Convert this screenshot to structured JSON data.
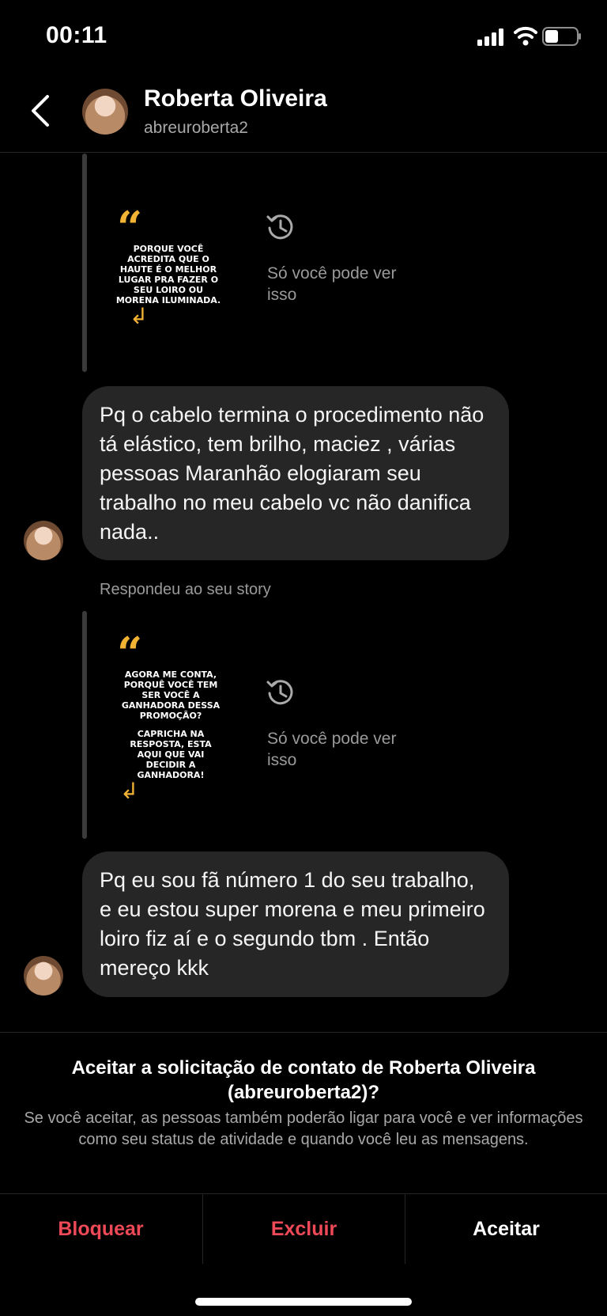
{
  "status_bar": {
    "time": "00:11",
    "icons": [
      "signal-icon",
      "wifi-icon",
      "battery-icon"
    ]
  },
  "header": {
    "name": "Roberta Oliveira",
    "username": "abreuroberta2",
    "back_icon": "chevron-left-icon"
  },
  "messages": [
    {
      "type": "story_reply",
      "story_text": "PORQUE VOCÊ ACREDITA QUE O HAUTE É O MELHOR LUGAR PRA FAZER O SEU LOIRO OU MORENA ILUMINADA.",
      "notice": "Só você pode ver isso"
    },
    {
      "type": "text",
      "text": "Pq o cabelo termina o procedimento não tá elástico, tem brilho, maciez , várias pessoas  Maranhão elogiaram seu trabalho no meu cabelo vc não danifica nada.."
    },
    {
      "type": "label",
      "text": "Respondeu ao seu story"
    },
    {
      "type": "story_reply",
      "story_text_1": "AGORA ME CONTA, PORQUÊ VOCÊ TEM SER VOCÊ A GANHADORA DESSA PROMOÇÃO?",
      "story_text_2": "CAPRICHA NA RESPOSTA, ESTA AQUI QUE VAI DECIDIR A GANHADORA!",
      "notice": "Só você pode ver isso"
    },
    {
      "type": "text",
      "text": "Pq eu sou fã número 1 do seu trabalho, e eu estou super morena e meu primeiro loiro fiz aí e o segundo tbm . Então mereço kkk"
    }
  ],
  "request_panel": {
    "title": "Aceitar a solicitação de contato de Roberta Oliveira (abreuroberta2)?",
    "description": "Se você aceitar, as pessoas também poderão ligar para você e ver informações como seu status de atividade e quando você leu as mensagens.",
    "block_label": "Bloquear",
    "delete_label": "Excluir",
    "accept_label": "Aceitar"
  },
  "colors": {
    "background": "#000000",
    "bubble": "#262626",
    "danger": "#ed4956",
    "accent_quote": "#f2b233"
  }
}
